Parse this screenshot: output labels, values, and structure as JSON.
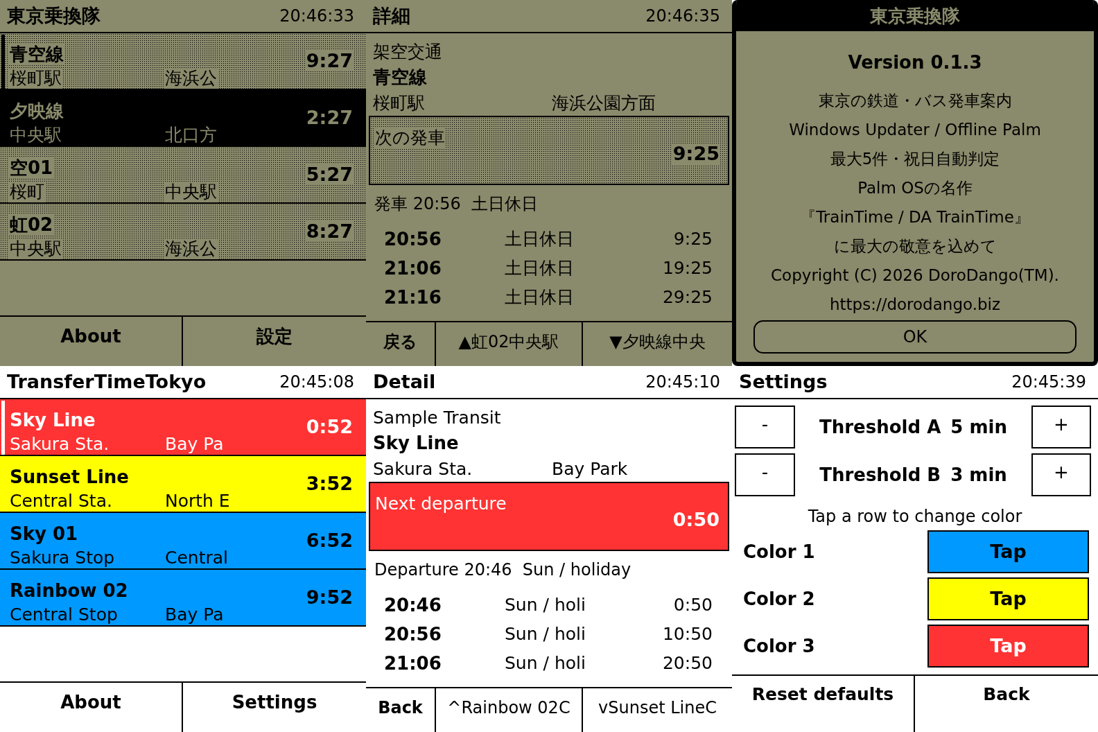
{
  "screens": [
    {
      "kind": "list",
      "grayscale": true,
      "title": "東京乗換隊",
      "clock": "20:46:33",
      "rows": [
        {
          "line": "青空線",
          "station": "桜町駅",
          "direction": "海浜公",
          "countdown": "9:27",
          "cursor": true,
          "highlighted": false
        },
        {
          "line": "夕映線",
          "station": "中央駅",
          "direction": "北口方",
          "countdown": "2:27",
          "cursor": false,
          "highlighted": true
        },
        {
          "line": "空01",
          "station": "桜町",
          "direction": "中央駅",
          "countdown": "5:27",
          "cursor": false,
          "highlighted": false
        },
        {
          "line": "虹02",
          "station": "中央駅",
          "direction": "海浜公",
          "countdown": "8:27",
          "cursor": false,
          "highlighted": false
        }
      ],
      "buttons": [
        {
          "label": "About"
        },
        {
          "label": "設定"
        }
      ]
    },
    {
      "kind": "detail",
      "grayscale": true,
      "title": "詳細",
      "clock": "20:46:35",
      "operator": "架空交通",
      "line": "青空線",
      "station": "桜町駅",
      "direction": "海浜公園方面",
      "next": {
        "label": "次の発車",
        "countdown": "9:25"
      },
      "summary": "発車 20:56  土日休日",
      "departures": [
        {
          "time": "20:56",
          "day_type": "土日休日",
          "countdown": "9:25"
        },
        {
          "time": "21:06",
          "day_type": "土日休日",
          "countdown": "19:25"
        },
        {
          "time": "21:16",
          "day_type": "土日休日",
          "countdown": "29:25"
        }
      ],
      "buttons": [
        {
          "kind": "back",
          "label": "戻る"
        },
        {
          "kind": "prev",
          "label": "▲虹02中央駅"
        },
        {
          "kind": "next",
          "label": "▼夕映線中央"
        }
      ]
    },
    {
      "kind": "about",
      "grayscale": true,
      "title": "東京乗換隊",
      "version": "Version 0.1.3",
      "lines": [
        "東京の鉄道・バス発車案内",
        "Windows Updater / Offline Palm",
        "最大5件・祝日自動判定",
        "Palm OSの名作",
        "『TrainTime / DA TrainTime』",
        "に最大の敬意を込めて",
        "Copyright (C) 2026 DoroDango(TM).",
        "https://dorodango.biz"
      ],
      "button": "OK"
    },
    {
      "kind": "list",
      "grayscale": false,
      "title": "TransferTimeTokyo",
      "clock": "20:45:08",
      "rows": [
        {
          "line": "Sky Line",
          "station": "Sakura Sta.",
          "direction": "Bay Pa",
          "countdown": "0:52",
          "cursor": true,
          "color": "#ff3333"
        },
        {
          "line": "Sunset Line",
          "station": "Central Sta.",
          "direction": "North E",
          "countdown": "3:52",
          "cursor": false,
          "color": "#ffff00"
        },
        {
          "line": "Sky 01",
          "station": "Sakura Stop",
          "direction": "Central",
          "countdown": "6:52",
          "cursor": false,
          "color": "#0099ff"
        },
        {
          "line": "Rainbow 02",
          "station": "Central Stop",
          "direction": "Bay Pa",
          "countdown": "9:52",
          "cursor": false,
          "color": "#0099ff"
        }
      ],
      "buttons": [
        {
          "label": "About"
        },
        {
          "label": "Settings"
        }
      ]
    },
    {
      "kind": "detail",
      "grayscale": false,
      "title": "Detail",
      "clock": "20:45:10",
      "operator": "Sample Transit",
      "line": "Sky Line",
      "station": "Sakura Sta.",
      "direction": "Bay Park",
      "next": {
        "label": "Next departure",
        "countdown": "0:50",
        "color": "#ff3333"
      },
      "summary": "Departure 20:46  Sun / holiday",
      "departures": [
        {
          "time": "20:46",
          "day_type": "Sun / holi",
          "countdown": "0:50"
        },
        {
          "time": "20:56",
          "day_type": "Sun / holi",
          "countdown": "10:50"
        },
        {
          "time": "21:06",
          "day_type": "Sun / holi",
          "countdown": "20:50"
        }
      ],
      "buttons": [
        {
          "kind": "back",
          "label": "Back"
        },
        {
          "kind": "prev",
          "label": "^Rainbow 02C"
        },
        {
          "kind": "next",
          "label": "vSunset LineC"
        }
      ]
    },
    {
      "kind": "settings",
      "grayscale": false,
      "title": "Settings",
      "clock": "20:45:39",
      "thresholds": [
        {
          "decrement": "-",
          "label": "Threshold A",
          "value": "5 min",
          "increment": "+"
        },
        {
          "decrement": "-",
          "label": "Threshold B",
          "value": "3 min",
          "increment": "+"
        }
      ],
      "hint": "Tap a row to change color",
      "colors": [
        {
          "label": "Color 1",
          "color": "#0099ff",
          "button": "Tap"
        },
        {
          "label": "Color 2",
          "color": "#ffff00",
          "button": "Tap"
        },
        {
          "label": "Color 3",
          "color": "#ff3333",
          "button": "Tap"
        }
      ],
      "buttons": [
        {
          "label": "Reset defaults"
        },
        {
          "label": "Back"
        }
      ]
    }
  ]
}
